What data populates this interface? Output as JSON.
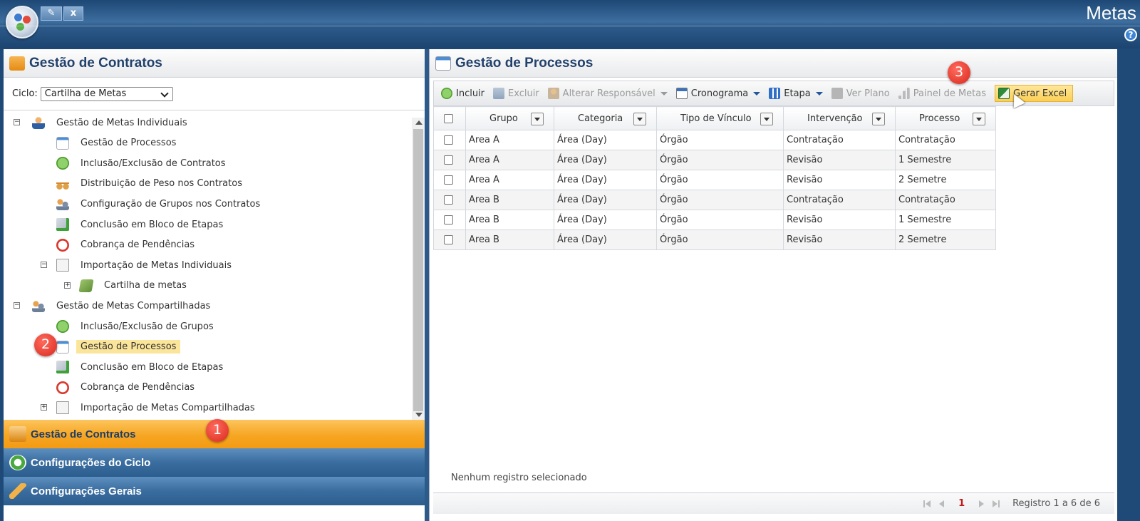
{
  "app": {
    "title": "Metas",
    "tool_btn_close": "x",
    "help": "?"
  },
  "left": {
    "title": "Gestão de Contratos",
    "cycle_label": "Ciclo:",
    "cycle_value": "Cartilha de Metas",
    "tree": [
      {
        "label": "Gestão de Metas Individuais",
        "icon": "person-icon",
        "expander": "−"
      },
      {
        "label": "Gestão de Processos",
        "icon": "calendar-icon"
      },
      {
        "label": "Inclusão/Exclusão de Contratos",
        "icon": "add-icon"
      },
      {
        "label": "Distribuição de Peso nos Contratos",
        "icon": "scale-icon"
      },
      {
        "label": "Configuração de Grupos nos Contratos",
        "icon": "group-gear-icon"
      },
      {
        "label": "Conclusão em Bloco de Etapas",
        "icon": "check-icon"
      },
      {
        "label": "Cobrança de Pendências",
        "icon": "clock-icon"
      },
      {
        "label": "Importação de Metas Individuais",
        "icon": "import-icon",
        "expander": "−"
      },
      {
        "label": "Cartilha de metas",
        "icon": "leaf-icon",
        "expander": "+"
      },
      {
        "label": "Gestão de Metas Compartilhadas",
        "icon": "group-icon",
        "expander": "−"
      },
      {
        "label": "Inclusão/Exclusão de Grupos",
        "icon": "add-icon"
      },
      {
        "label": "Gestão de Processos",
        "icon": "calendar-icon"
      },
      {
        "label": "Conclusão em Bloco de Etapas",
        "icon": "check-icon"
      },
      {
        "label": "Cobrança de Pendências",
        "icon": "clock-icon"
      },
      {
        "label": "Importação de Metas Compartilhadas",
        "icon": "import-icon",
        "expander": "+"
      }
    ],
    "accordion": [
      "Gestão de Contratos",
      "Configurações do Ciclo",
      "Configurações Gerais"
    ]
  },
  "badges": [
    "1",
    "2",
    "3"
  ],
  "right": {
    "title": "Gestão de Processos",
    "toolbar": {
      "incluir": "Incluir",
      "excluir": "Excluir",
      "alterar": "Alterar Responsável",
      "cronograma": "Cronograma",
      "etapa": "Etapa",
      "ver_plano": "Ver Plano",
      "painel": "Painel de Metas",
      "gerar_excel": "Gerar Excel"
    },
    "columns": [
      "Grupo",
      "Categoria",
      "Tipo de Vínculo",
      "Intervenção",
      "Processo"
    ],
    "rows": [
      [
        "Area A",
        "Área (Day)",
        "Órgão",
        "Contratação",
        "Contratação"
      ],
      [
        "Area A",
        "Área (Day)",
        "Órgão",
        "Revisão",
        "1 Semestre"
      ],
      [
        "Area A",
        "Área (Day)",
        "Órgão",
        "Revisão",
        "2 Semetre"
      ],
      [
        "Area B",
        "Área (Day)",
        "Órgão",
        "Contratação",
        "Contratação"
      ],
      [
        "Area B",
        "Área (Day)",
        "Órgão",
        "Revisão",
        "1 Semestre"
      ],
      [
        "Area B",
        "Área (Day)",
        "Órgão",
        "Revisão",
        "2 Semetre"
      ]
    ],
    "status": "Nenhum registro selecionado",
    "pager": {
      "page": "1",
      "summary": "Registro 1 a 6 de 6"
    }
  },
  "colors": {
    "accent_orange": "#f6a623",
    "nav_blue": "#3a6d9f",
    "badge_red": "#d9281c",
    "highlight": "#fbe59a"
  }
}
